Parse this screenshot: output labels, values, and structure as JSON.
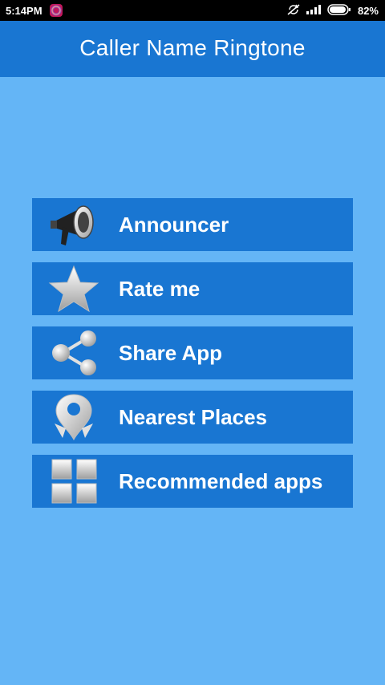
{
  "status_bar": {
    "time": "5:14PM",
    "battery": "82%",
    "icons": [
      "app-notification-icon",
      "sync-icon",
      "signal-icon",
      "battery-icon"
    ]
  },
  "app": {
    "title": "Caller Name Ringtone"
  },
  "menu": {
    "items": [
      {
        "label": "Announcer",
        "icon": "megaphone-icon"
      },
      {
        "label": "Rate me",
        "icon": "star-icon"
      },
      {
        "label": "Share App",
        "icon": "share-icon"
      },
      {
        "label": "Nearest Places",
        "icon": "location-pin-icon"
      },
      {
        "label": "Recommended apps",
        "icon": "grid-icon"
      }
    ]
  },
  "colors": {
    "background": "#64b5f6",
    "primary": "#1976d2",
    "status_bar": "#000000",
    "text": "#ffffff"
  }
}
